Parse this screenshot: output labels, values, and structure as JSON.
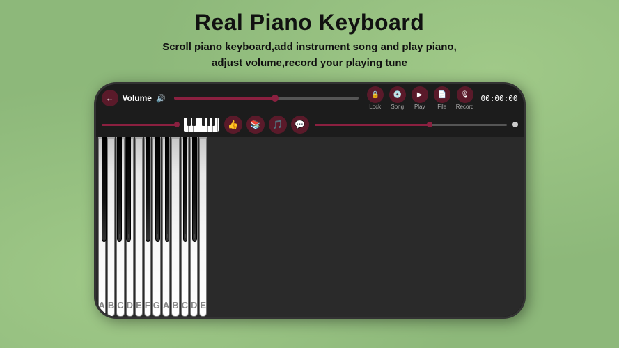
{
  "page": {
    "title": "Real Piano Keyboard",
    "subtitle_line1": "Scroll piano keyboard,add instrument song and play piano,",
    "subtitle_line2": "adjust volume,record your playing tune"
  },
  "app": {
    "volume_label": "Volume",
    "timer": "00:00:00",
    "icons": [
      {
        "label": "Lock",
        "symbol": "🔒"
      },
      {
        "label": "Song",
        "symbol": "💿"
      },
      {
        "label": "Play",
        "symbol": "▶"
      },
      {
        "label": "File",
        "symbol": "📄"
      },
      {
        "label": "Record",
        "symbol": "🎙"
      }
    ],
    "piano_keys": [
      "A",
      "B",
      "C",
      "D",
      "E",
      "F",
      "G",
      "A",
      "B",
      "C",
      "D",
      "E"
    ]
  }
}
